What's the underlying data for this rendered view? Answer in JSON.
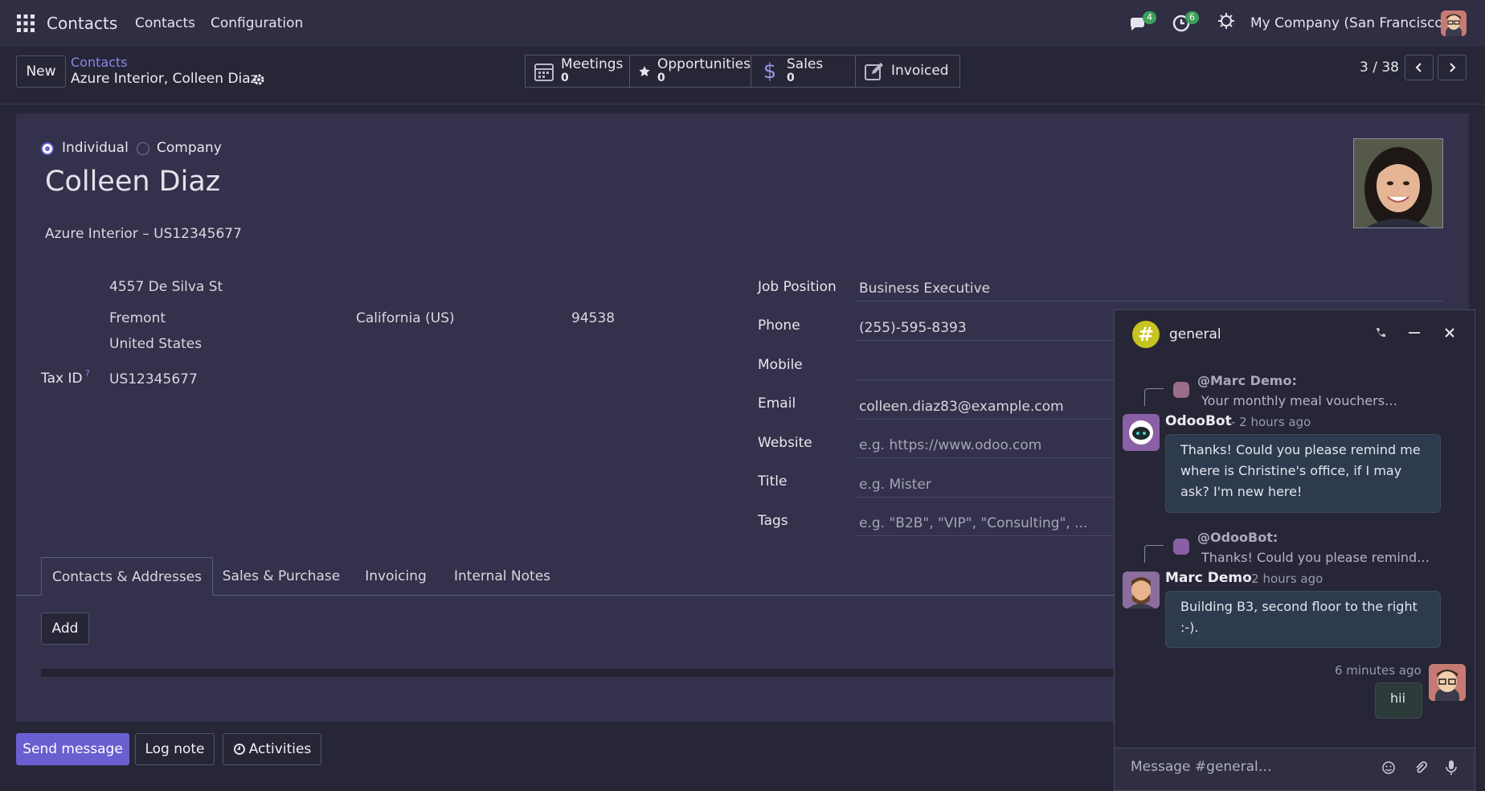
{
  "navbar": {
    "app_title": "Contacts",
    "menu": [
      "Contacts",
      "Configuration"
    ],
    "chat_count": "4",
    "activity_count": "6",
    "company": "My Company (San Francisco)"
  },
  "control_panel": {
    "new_label": "New",
    "breadcrumb_parent": "Contacts",
    "breadcrumb_current": "Azure Interior, Colleen Diaz",
    "pager": "3 / 38",
    "smart_buttons": [
      {
        "label": "Meetings",
        "value": "0",
        "icon": "calendar-icon"
      },
      {
        "label": "Opportunities",
        "value": "0",
        "icon": "star-icon"
      },
      {
        "label": "Sales",
        "value": "0",
        "icon": "dollar-icon"
      },
      {
        "label": "Invoiced",
        "value": "",
        "icon": "pencil-square-icon"
      }
    ]
  },
  "form": {
    "type_individual": "Individual",
    "type_company": "Company",
    "selected_type": "Individual",
    "name": "Colleen Diaz",
    "company_line": "Azure Interior – US12345677",
    "street": "4557 De Silva St",
    "city": "Fremont",
    "state": "California (US)",
    "zip": "94538",
    "country": "United States",
    "tax_id_label": "Tax ID",
    "tax_id_help": "?",
    "tax_id": "US12345677",
    "fields": {
      "job_position": {
        "label": "Job Position",
        "value": "Business Executive"
      },
      "phone": {
        "label": "Phone",
        "value": "(255)-595-8393"
      },
      "mobile": {
        "label": "Mobile",
        "value": ""
      },
      "email": {
        "label": "Email",
        "value": "colleen.diaz83@example.com"
      },
      "website": {
        "label": "Website",
        "placeholder": "e.g. https://www.odoo.com"
      },
      "title": {
        "label": "Title",
        "placeholder": "e.g. Mister"
      },
      "tags": {
        "label": "Tags",
        "placeholder": "e.g. \"B2B\", \"VIP\", \"Consulting\", ..."
      }
    },
    "tabs": [
      "Contacts & Addresses",
      "Sales & Purchase",
      "Invoicing",
      "Internal Notes"
    ],
    "active_tab": "Contacts & Addresses",
    "add_label": "Add"
  },
  "chatter": {
    "send_message": "Send message",
    "log_note": "Log note",
    "activities": "Activities"
  },
  "chat": {
    "channel": "general",
    "messages": [
      {
        "reply_to": "@Marc Demo:",
        "reply_snippet": "Your monthly meal vouchers…",
        "author": "OdooBot",
        "time": " - 2 hours ago",
        "text": "Thanks! Could you please remind me where is Christine's office, if I may ask? I'm new here!"
      },
      {
        "reply_to": "@OdooBot:",
        "reply_snippet": "Thanks! Could you please remind…",
        "author": "Marc Demo",
        "time": " - 2 hours ago",
        "text": "Building B3, second floor to the right :-)."
      },
      {
        "time": "6 minutes ago",
        "text": "hii"
      }
    ],
    "input_placeholder": "Message #general…"
  },
  "colors": {
    "accent": "#6a5fd0",
    "badge_green": "#3ea05a",
    "channel_icon": "#c6c41f"
  }
}
